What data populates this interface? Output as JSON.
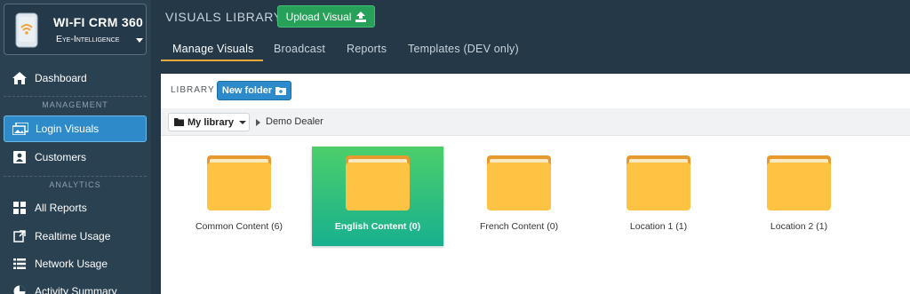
{
  "brand": {
    "title": "WI-FI CRM 360",
    "subtitle": "Eye-Intelligence"
  },
  "sidebar": {
    "items": [
      {
        "label": "Dashboard",
        "icon": "home-icon"
      },
      {
        "label": "Login Visuals",
        "icon": "images-icon",
        "active": true
      },
      {
        "label": "Customers",
        "icon": "contact-card-icon"
      },
      {
        "label": "All Reports",
        "icon": "grid-icon"
      },
      {
        "label": "Realtime Usage",
        "icon": "external-doc-icon"
      },
      {
        "label": "Network Usage",
        "icon": "list-icon"
      },
      {
        "label": "Activity Summary",
        "icon": "pie-icon"
      }
    ],
    "sections": {
      "management": "MANAGEMENT",
      "analytics": "ANALYTICS"
    }
  },
  "header": {
    "title": "VISUALS LIBRARY",
    "upload_label": "Upload Visual",
    "tabs": [
      {
        "label": "Manage Visuals",
        "active": true
      },
      {
        "label": "Broadcast"
      },
      {
        "label": "Reports"
      },
      {
        "label": "Templates (DEV only)"
      }
    ]
  },
  "library": {
    "label": "LIBRARY",
    "new_folder_label": "New folder",
    "breadcrumb": {
      "root": "My library",
      "current": "Demo Dealer"
    },
    "folders": [
      {
        "name": "Common Content (6)"
      },
      {
        "name": "English Content (0)",
        "selected": true
      },
      {
        "name": "French Content (0)"
      },
      {
        "name": "Location 1 (1)"
      },
      {
        "name": "Location 2 (1)"
      }
    ]
  },
  "colors": {
    "accent": "#2e8ac9",
    "success": "#27a05a",
    "tab_underline": "#e8a83a",
    "folder": "#f5b53a",
    "selected_folder": "#18b08f"
  }
}
